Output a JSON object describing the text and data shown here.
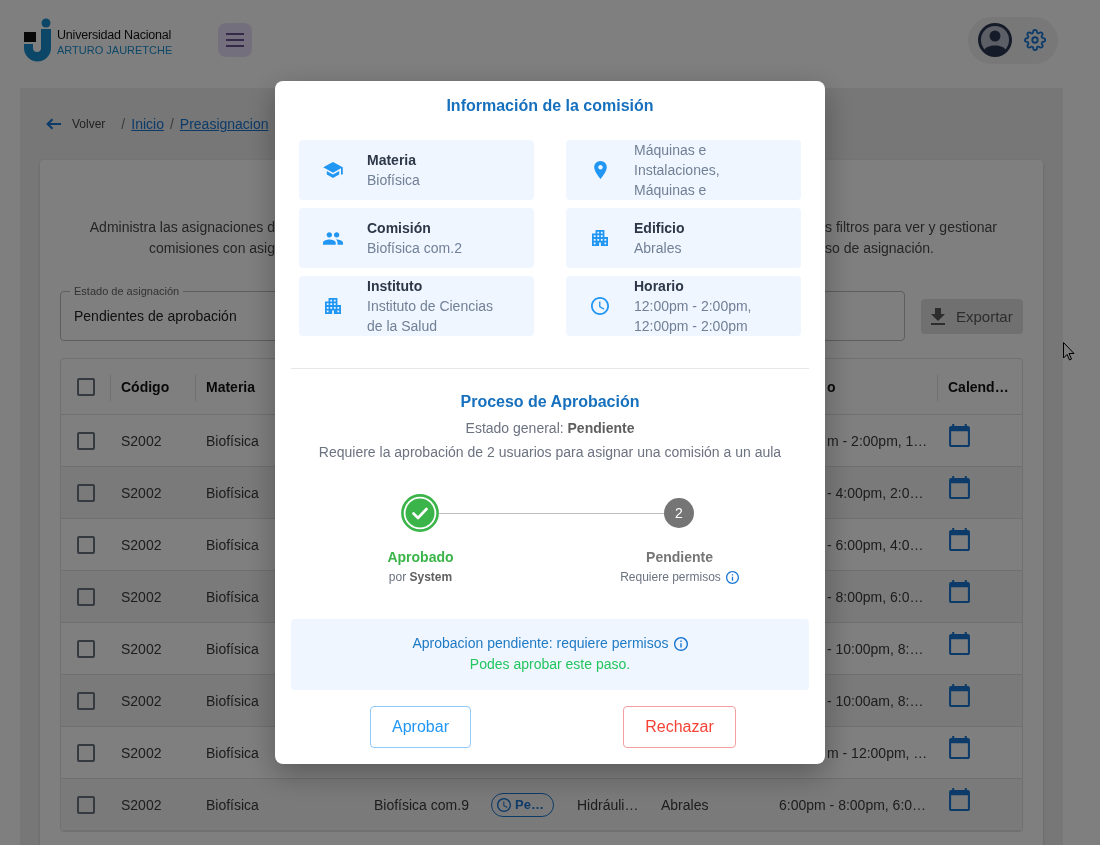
{
  "header": {
    "logo": {
      "line_1": "Universidad Nacional",
      "line_2": "ARTURO JAURETCHE"
    }
  },
  "breadcrumb": {
    "back": "Volver",
    "separator": "/",
    "items": [
      {
        "label": "Inicio"
      },
      {
        "label": "Preasignacion"
      }
    ]
  },
  "description_lines": [
    {
      "left": "Administra las asignaciones d",
      "right": "s filtros para ver y gestionar"
    },
    {
      "left": "comisiones con asig",
      "right": "so de asignación."
    }
  ],
  "filter": {
    "label": "Estado de asignación",
    "value": "Pendientes de aprobación"
  },
  "export_button": {
    "label": "Exportar",
    "disabled": true
  },
  "table": {
    "select_all": {
      "checked": false
    },
    "columns": [
      "Código",
      "Materia",
      "o",
      "Calend…"
    ],
    "rows": [
      {
        "checked": false,
        "code": "S2002",
        "subject": "Biofísica",
        "column_7": "m - 2:00pm, 1…"
      },
      {
        "checked": false,
        "code": "S2002",
        "subject": "Biofísica",
        "column_7": "- 4:00pm, 2:0…"
      },
      {
        "checked": false,
        "code": "S2002",
        "subject": "Biofísica",
        "column_7": "- 6:00pm, 4:0…"
      },
      {
        "checked": false,
        "code": "S2002",
        "subject": "Biofísica",
        "column_7": "- 8:00pm, 6:0…"
      },
      {
        "checked": false,
        "code": "S2002",
        "subject": "Biofísica",
        "column_7": "- 10:00pm, 8:…"
      },
      {
        "checked": false,
        "code": "S2002",
        "subject": "Biofísica",
        "column_7": "- 10:00am, 8:…"
      },
      {
        "checked": false,
        "code": "S2002",
        "subject": "Biofísica",
        "column_7": "m - 12:00pm, …"
      },
      {
        "checked": false,
        "code": "S2002",
        "subject": "Biofísica",
        "column_3": "Biofísica com.9",
        "column_4": "Pe…",
        "column_5": "Hidráuli…",
        "column_6": "Abrales",
        "column_7": "6:00pm - 8:00pm, 6:0…"
      }
    ]
  },
  "modal": {
    "title": "Información de la comisión",
    "info_cards": [
      {
        "label": "Materia",
        "value": "Biofísica"
      },
      {
        "label": "Comisión",
        "value": "Biofísica com.2"
      },
      {
        "label": "Instituto",
        "value": "Instituto de Ciencias de la Salud"
      },
      {
        "value": "Máquinas e Instalaciones, Máquinas e"
      },
      {
        "label": "Edificio",
        "value": "Abrales"
      },
      {
        "label": "Horario",
        "value": "12:00pm - 2:00pm, 12:00pm - 2:00pm"
      }
    ],
    "process": {
      "title": "Proceso de Aprobación",
      "overall": "Estado general: **Pendiente**",
      "requirement": "Requiere la aprobación de 2 usuarios para asignar una comisión a un aula",
      "steps": [
        {
          "completed": true,
          "label": "Aprobado",
          "detail": "por **System**",
          "info": false
        },
        {
          "completed": false,
          "number": "2",
          "label": "Pendiente",
          "detail": "Requiere permisos",
          "info": true
        }
      ]
    },
    "notice": {
      "message": "Aprobacion pendiente: requiere permisos",
      "info": true,
      "note": "Podes aprobar este paso."
    },
    "actions": [
      {
        "kind": "approve",
        "label": "Aprobar"
      },
      {
        "kind": "reject",
        "label": "Rechazar"
      }
    ]
  }
}
